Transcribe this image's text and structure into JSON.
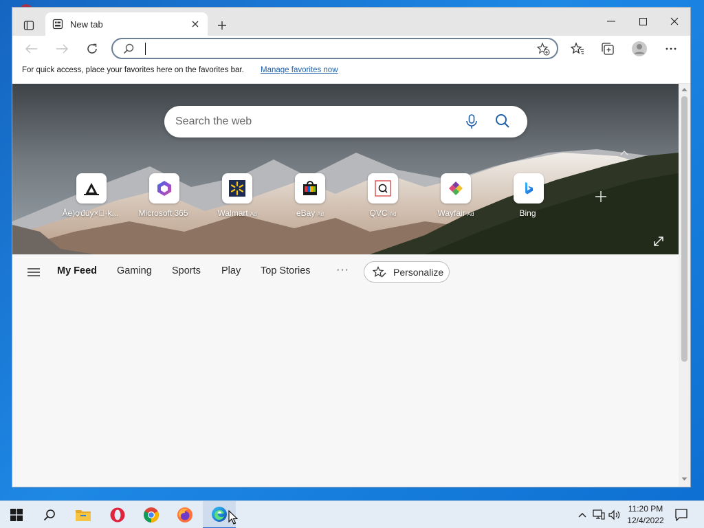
{
  "browser": {
    "tab_title": "New tab",
    "address_value": "",
    "favorites_bar_message": "For quick access, place your favorites here on the favorites bar.",
    "manage_favorites_link": "Manage favorites now"
  },
  "newtab": {
    "search_placeholder": "Search the web",
    "quick_links": [
      {
        "label": "Åe)ợđûy×⃝·ķ...",
        "ad": "",
        "icon": "sign-icon"
      },
      {
        "label": "Microsoft 365",
        "ad": "",
        "icon": "microsoft-365-icon"
      },
      {
        "label": "Walmart",
        "ad": "Ad",
        "icon": "walmart-icon"
      },
      {
        "label": "eBay",
        "ad": "Ad",
        "icon": "ebay-icon"
      },
      {
        "label": "QVC",
        "ad": "Ad",
        "icon": "qvc-icon"
      },
      {
        "label": "Wayfair",
        "ad": "Ad",
        "icon": "wayfair-icon"
      },
      {
        "label": "Bing",
        "ad": "",
        "icon": "bing-icon"
      }
    ],
    "feed_nav": [
      "My Feed",
      "Gaming",
      "Sports",
      "Play",
      "Top Stories"
    ],
    "more_label": "···",
    "personalize_label": "Personalize"
  },
  "taskbar": {
    "apps": [
      "start-icon",
      "search-icon",
      "file-explorer-icon",
      "opera-icon",
      "chrome-icon",
      "firefox-icon",
      "edge-icon"
    ],
    "active_app": "edge-icon",
    "time": "11:20 PM",
    "date": "12/4/2022"
  },
  "colors": {
    "accent": "#1f5fa8",
    "desktop": "#1976d2",
    "taskbar": "#e4ecf5"
  }
}
